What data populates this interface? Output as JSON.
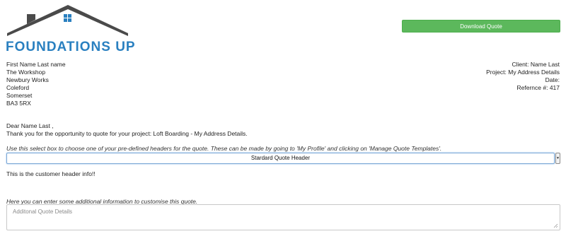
{
  "brand": {
    "name": "FOUNDATIONS UP",
    "roof_color": "#4a4a4a",
    "text_color": "#2a80c0",
    "window_color": "#2a80c0"
  },
  "actions": {
    "download_label": "Download Quote",
    "accent": "#5cb85c"
  },
  "customer_address": {
    "lines": [
      "First Name Last name",
      "The Workshop",
      "Newbury Works",
      "Coleford",
      "Somerset",
      "BA3 5RX"
    ]
  },
  "quote_meta": {
    "client": "Client: Name Last",
    "project": "Project: My Address Details",
    "date": "Date:",
    "reference": "Refernce #: 417"
  },
  "letter": {
    "salutation": "Dear Name Last ,",
    "thanks": "Thank you for the opportunity to quote for your project: Loft Boarding - My Address Details."
  },
  "header_select": {
    "hint": "Use this select box to choose one of your pre-defined headers for the quote. These can be made by going to 'My Profile' and clicking on 'Manage Quote Templates'.",
    "selected": "Stardard Quote Header",
    "customer_header_info": "This is the customer header info!!"
  },
  "additional_details": {
    "hint": "Here you can enter some additional information to customise this quote.",
    "placeholder": "Additonal Quote Details"
  }
}
